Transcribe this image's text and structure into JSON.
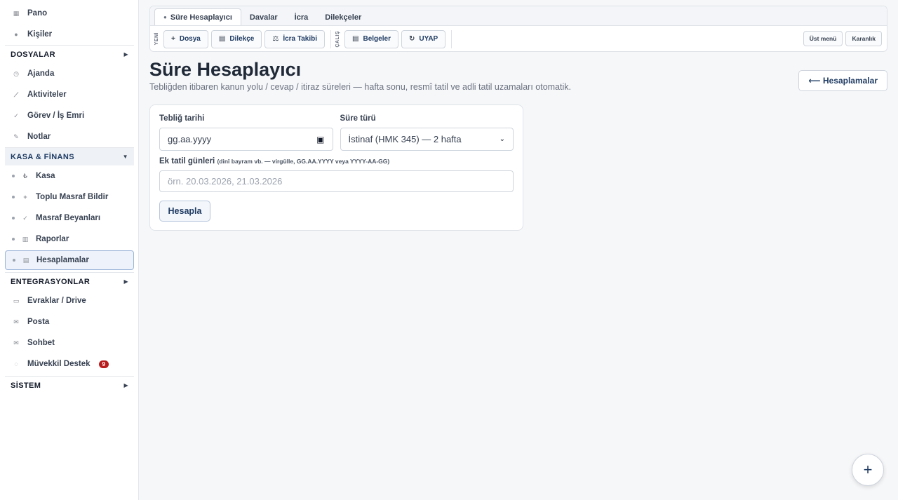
{
  "sidebar": {
    "top_items": [
      {
        "label": "Pano",
        "icon": "dashboard-icon"
      },
      {
        "label": "Kişiler",
        "icon": "contacts-icon"
      }
    ],
    "sections": {
      "dosyalar": {
        "label": "DOSYALAR",
        "arrow": "▶"
      },
      "kasa": {
        "label": "KASA & FİNANS",
        "arrow": "▼"
      },
      "entegrasyonlar": {
        "label": "ENTEGRASYONLAR",
        "arrow": "▶"
      },
      "sistem": {
        "label": "SİSTEM",
        "arrow": "▶"
      }
    },
    "mid_items": [
      {
        "label": "Ajanda",
        "icon": "clock-icon"
      },
      {
        "label": "Aktiviteler",
        "icon": "activity-icon"
      },
      {
        "label": "Görev / İş Emri",
        "icon": "check-icon"
      },
      {
        "label": "Notlar",
        "icon": "pencil-icon"
      }
    ],
    "kasa_items": [
      {
        "label": "Kasa",
        "icon": "lira-icon"
      },
      {
        "label": "Toplu Masraf Bildir",
        "icon": "plus-icon"
      },
      {
        "label": "Masraf Beyanları",
        "icon": "check-icon"
      },
      {
        "label": "Raporlar",
        "icon": "chart-icon"
      },
      {
        "label": "Hesaplamalar",
        "icon": "calculator-icon"
      }
    ],
    "entegrasyon_items": [
      {
        "label": "Evraklar / Drive",
        "icon": "folder-icon"
      },
      {
        "label": "Posta",
        "icon": "mail-icon"
      },
      {
        "label": "Sohbet",
        "icon": "mail-icon"
      },
      {
        "label": "Müvekkil Destek",
        "icon": "chat-icon",
        "badge": "9"
      }
    ]
  },
  "tabs": [
    "Süre Hesaplayıcı",
    "Davalar",
    "İcra",
    "Dilekçeler"
  ],
  "toolbar": {
    "yeni_label": "YENİ",
    "calis_label": "ÇALIŞ",
    "dosya": "Dosya",
    "dilekce": "Dilekçe",
    "icra_takibi": "İcra Takibi",
    "belgeler": "Belgeler",
    "uyap": "UYAP",
    "ust_menu": "Üst menü",
    "karanlik": "Karanlık"
  },
  "page": {
    "title": "Süre Hesaplayıcı",
    "subtitle": "Tebliğden itibaren kanun yolu / cevap / itiraz süreleri — hafta sonu, resmî tatil ve adli tatil uzamaları otomatik.",
    "back_button": "⟵ Hesaplamalar"
  },
  "form": {
    "teblig_label": "Tebliğ tarihi",
    "teblig_placeholder": "gg.aa.yyyy",
    "sure_label": "Süre türü",
    "sure_value": "İstinaf (HMK 345) — 2 hafta",
    "tatil_label": "Ek tatil günleri",
    "tatil_hint": "(dinî bayram vb. — virgülle, GG.AA.YYYY veya YYYY-AA-GG)",
    "tatil_placeholder": "örn. 20.03.2026, 21.03.2026",
    "submit": "Hesapla"
  },
  "fab": "+"
}
